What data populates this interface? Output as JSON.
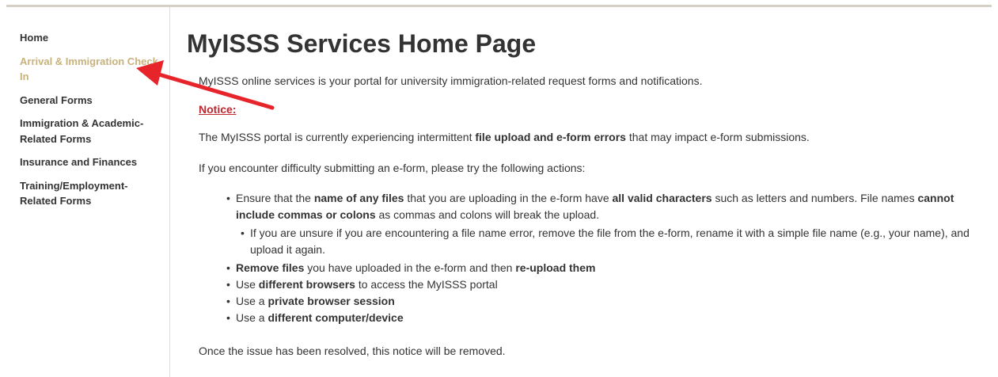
{
  "sidebar": {
    "items": [
      {
        "label": "Home"
      },
      {
        "label": "Arrival & Immigration Check-In"
      },
      {
        "label": "General Forms"
      },
      {
        "label": "Immigration & Academic-Related Forms"
      },
      {
        "label": "Insurance and Finances"
      },
      {
        "label": "Training/Employment-Related Forms"
      }
    ],
    "active_index": 1,
    "active_color": "#c8b27c"
  },
  "main": {
    "title": "MyISSS Services Home Page",
    "intro": "MyISSS online services is your portal for university immigration-related request forms and notifications.",
    "notice_heading": "Notice:",
    "notice_color": "#c0262d",
    "para1": {
      "pre": "The MyISSS portal is currently experiencing intermittent ",
      "bold": "file upload and e-form errors",
      "post": " that may impact e-form submissions."
    },
    "para2": "If you encounter difficulty submitting an e-form, please try the following actions:",
    "bullet1": {
      "t1": "Ensure that the ",
      "b1": "name of any files",
      "t2": " that you are uploading in the e-form have ",
      "b2": "all valid characters",
      "t3": " such as letters and numbers. File names ",
      "b3": "cannot include commas or colons",
      "t4": " as commas and colons will break the upload."
    },
    "subbullet": "If you are unsure if you are encountering a file name error, remove the file from the e-form, rename it with a simple file name (e.g., your name), and upload it again.",
    "bullet2": {
      "b1": "Remove files",
      "t1": " you have uploaded in the e-form and then ",
      "b2": "re-upload them"
    },
    "bullet3": {
      "t1": "Use ",
      "b1": "different browsers",
      "t2": " to access the MyISSS portal"
    },
    "bullet4": {
      "t1": "Use a ",
      "b1": "private browser session"
    },
    "bullet5": {
      "t1": "Use a ",
      "b1": "different computer/device"
    },
    "outro": "Once the issue has been resolved, this notice will be removed."
  },
  "annotation": {
    "arrow_color": "#e8242b"
  }
}
